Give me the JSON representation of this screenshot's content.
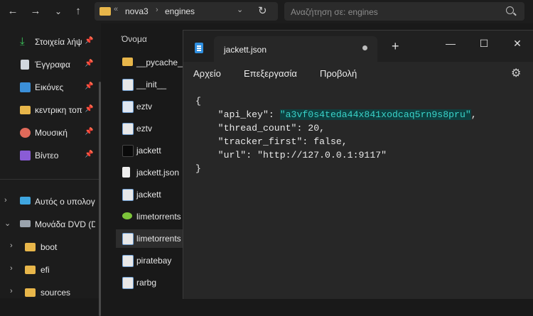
{
  "explorer": {
    "nav": {
      "back": "←",
      "forward": "→",
      "dropdown": "⌄",
      "up": "↑"
    },
    "address": {
      "overflow": "«",
      "segments": [
        "nova3",
        "engines"
      ],
      "separator": "›",
      "dropdown": "⌄",
      "refresh": "↻"
    },
    "search": {
      "placeholder": "Αναζήτηση σε: engines"
    },
    "sidebar": {
      "quick_access": [
        {
          "label": "Στοιχεία λήψ",
          "icon": "download-icon",
          "color": "#3cc85c"
        },
        {
          "label": "Έγγραφα",
          "icon": "documents-icon",
          "color": "#d0d6de"
        },
        {
          "label": "Εικόνες",
          "icon": "pictures-icon",
          "color": "#3b8fd8"
        },
        {
          "label": "κεντρικη τοπ",
          "icon": "folder-icon",
          "color": "#e8b64a"
        },
        {
          "label": "Μουσική",
          "icon": "music-icon",
          "color": "#e06a5a"
        },
        {
          "label": "Βίντεο",
          "icon": "video-icon",
          "color": "#8a5cd6"
        }
      ],
      "tree": [
        {
          "label": "Αυτός ο υπολογ",
          "icon": "computer-icon",
          "color": "#3fa6e0",
          "chevron": "›"
        },
        {
          "label": "Μονάδα DVD (D",
          "icon": "dvd-drive-icon",
          "color": "#9aa3ad",
          "chevron": "⌄"
        },
        {
          "label": "boot",
          "icon": "folder-icon",
          "color": "#e8b64a",
          "chevron": "›"
        },
        {
          "label": "efi",
          "icon": "folder-icon",
          "color": "#e8b64a",
          "chevron": "›"
        },
        {
          "label": "sources",
          "icon": "folder-icon",
          "color": "#e8b64a",
          "chevron": "›"
        }
      ]
    },
    "file_list": {
      "column_header": "Όνομα",
      "files": [
        {
          "name": "__pycache__",
          "icon": "folder-icon",
          "color": "#e8b64a"
        },
        {
          "name": "__init__",
          "icon": "python-file-icon",
          "color": "#6e9fd4"
        },
        {
          "name": "eztv",
          "icon": "image-file-icon",
          "color": "#6e9fd4"
        },
        {
          "name": "eztv",
          "icon": "python-file-icon",
          "color": "#6e9fd4"
        },
        {
          "name": "jackett",
          "icon": "jackett-image-icon",
          "color": "#111111"
        },
        {
          "name": "jackett.json",
          "icon": "file-icon",
          "color": "#eeeeee"
        },
        {
          "name": "jackett",
          "icon": "python-file-icon",
          "color": "#6e9fd4"
        },
        {
          "name": "limetorrents",
          "icon": "lime-image-icon",
          "color": "#7cc43a"
        },
        {
          "name": "limetorrents",
          "icon": "python-file-icon",
          "color": "#6e9fd4"
        },
        {
          "name": "piratebay",
          "icon": "python-file-icon",
          "color": "#6e9fd4"
        },
        {
          "name": "rarbg",
          "icon": "python-file-icon",
          "color": "#6e9fd4"
        }
      ]
    }
  },
  "notepad": {
    "tab_title": "jackett.json",
    "add_tab": "+",
    "window_controls": {
      "minimize": "—",
      "maximize": "☐",
      "close": "✕"
    },
    "menu": [
      "Αρχείο",
      "Επεξεργασία",
      "Προβολή"
    ],
    "settings_icon": "⚙",
    "content": {
      "open": "{",
      "lines": [
        {
          "key": "\"api_key\"",
          "value": "\"a3vf0s4teda44x841xodcaq5rn9s8pru\"",
          "value_highlighted": true,
          "tail": ","
        },
        {
          "key": "\"thread_count\"",
          "value": "20",
          "value_highlighted": false,
          "tail": ","
        },
        {
          "key": "\"tracker_first\"",
          "value": "false",
          "value_highlighted": false,
          "tail": ","
        },
        {
          "key": "\"url\"",
          "value": "\"http://127.0.0.1:9117\"",
          "value_highlighted": false,
          "tail": ""
        }
      ],
      "close": "}"
    }
  }
}
